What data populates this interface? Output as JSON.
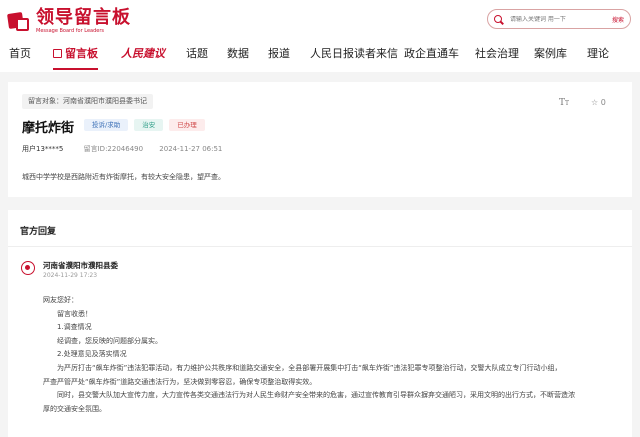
{
  "header": {
    "logo_cn": "领导留言板",
    "logo_en": "Message Board for Leaders",
    "search_placeholder": "请输入关键词 用一下",
    "search_button": "搜索"
  },
  "nav": {
    "items": [
      "首页",
      "留言板",
      "人民建议",
      "话题",
      "数据",
      "报道",
      "人民日报读者来信",
      "政企直通车",
      "社会治理",
      "案例库",
      "理论"
    ]
  },
  "message": {
    "target_label": "留言对象：",
    "target": "河南省濮阳市濮阳县委书记",
    "title": "摩托炸街",
    "tags": [
      "投诉/求助",
      "治安",
      "已办理"
    ],
    "user": "用户13****5",
    "id_label": "留言ID:22046490",
    "time": "2024-11-27 06:51",
    "like_count": "0",
    "font_icon": "T",
    "content": "城西中学学校是西路附近有炸街摩托，有较大安全隐患，望严查。"
  },
  "reply": {
    "section_title": "官方回复",
    "org": "河南省濮阳市濮阳县委",
    "time": "2024-11-29 17:23",
    "lines": [
      "网友您好：",
      "留言收悉！",
      "1.调查情况",
      "经调查，您反映的问题部分属实。",
      "2.处理意见及落实情况",
      "为严厉打击“飙车炸街”违法犯罪活动，有力维护公共秩序和道路交通安全，全县部署开展集中打击“飙车炸街”违法犯罪专项整治行动，交警大队成立专门行动小组，",
      "严查严管严处“飙车炸街”道路交通违法行为，坚决做到零容忍，确保专项整治取得实效。",
      "同时，县交警大队加大宣传力度，大力宣传各类交通违法行为对人民生命财产安全带来的危害，通过宣传教育引导群众摒弃交通陋习，采用文明的出行方式，不断营造浓",
      "厚的交通安全氛围。"
    ]
  }
}
